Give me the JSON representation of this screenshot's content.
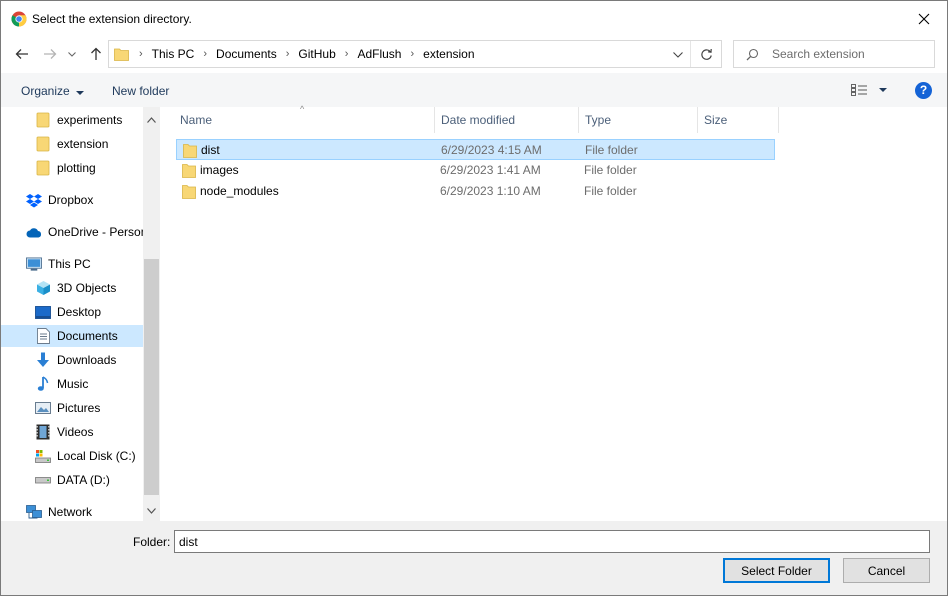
{
  "window": {
    "title": "Select the extension directory.",
    "app_icon": "chrome-icon",
    "close_icon": "close-icon"
  },
  "navigation": {
    "back_icon": "back-arrow-icon",
    "forward_icon": "forward-arrow-icon",
    "recent_icon": "chevron-down-icon",
    "up_icon": "up-arrow-icon",
    "breadcrumbs": [
      "This PC",
      "Documents",
      "GitHub",
      "AdFlush",
      "extension"
    ],
    "refresh_icon": "refresh-icon",
    "search_placeholder": "Search extension"
  },
  "toolbar": {
    "organize_label": "Organize",
    "new_folder_label": "New folder",
    "view_icon": "details-view-icon",
    "help_label": "?"
  },
  "sidebar": {
    "items": [
      {
        "label": "experiments",
        "icon": "folder-icon"
      },
      {
        "label": "extension",
        "icon": "folder-icon"
      },
      {
        "label": "plotting",
        "icon": "folder-icon"
      },
      {
        "label": "Dropbox",
        "icon": "dropbox-icon"
      },
      {
        "label": "OneDrive - Personal",
        "icon": "onedrive-cloud-icon"
      },
      {
        "label": "This PC",
        "icon": "computer-icon"
      },
      {
        "label": "3D Objects",
        "icon": "3d-objects-icon"
      },
      {
        "label": "Desktop",
        "icon": "desktop-icon"
      },
      {
        "label": "Documents",
        "icon": "documents-icon",
        "selected": true
      },
      {
        "label": "Downloads",
        "icon": "download-icon"
      },
      {
        "label": "Music",
        "icon": "music-icon"
      },
      {
        "label": "Pictures",
        "icon": "pictures-icon"
      },
      {
        "label": "Videos",
        "icon": "videos-icon"
      },
      {
        "label": "Local Disk (C:)",
        "icon": "local-disk-icon"
      },
      {
        "label": "DATA (D:)",
        "icon": "drive-icon"
      },
      {
        "label": "Network",
        "icon": "network-icon"
      }
    ]
  },
  "file_list": {
    "columns": [
      "Name",
      "Date modified",
      "Type",
      "Size"
    ],
    "rows": [
      {
        "name": "dist",
        "date": "6/29/2023 4:15 AM",
        "type": "File folder",
        "selected": true
      },
      {
        "name": "images",
        "date": "6/29/2023 1:41 AM",
        "type": "File folder"
      },
      {
        "name": "node_modules",
        "date": "6/29/2023 1:10 AM",
        "type": "File folder"
      }
    ]
  },
  "bottom": {
    "folder_label": "Folder:",
    "folder_value": "dist",
    "select_button": "Select Folder",
    "cancel_button": "Cancel"
  },
  "colors": {
    "selection": "#cce8ff",
    "selection_border": "#99d1ff",
    "primary_button_border": "#0078d7",
    "folder_yellow": "#f8d775",
    "help_blue": "#1463d6"
  }
}
